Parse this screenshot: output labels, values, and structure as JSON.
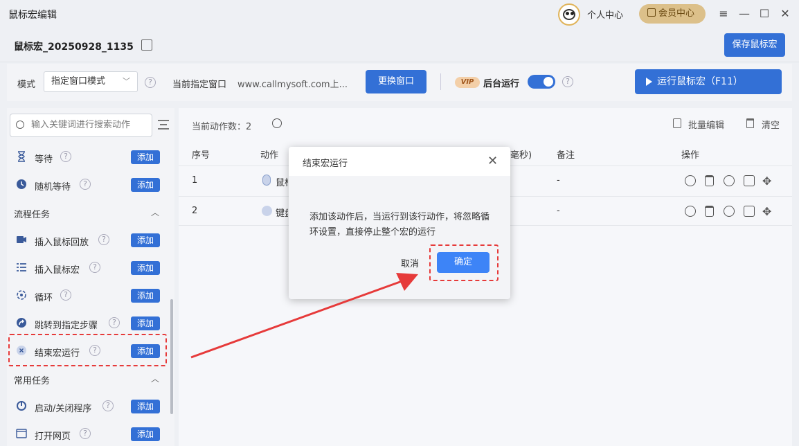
{
  "titlebar": {
    "app_title": "鼠标宏编辑",
    "personal_center": "个人中心",
    "member_center": "会员中心",
    "minimize_glyph": "—",
    "maximize_glyph": "☐",
    "close_glyph": "✕"
  },
  "macro": {
    "name": "鼠标宏_20250928_1135",
    "save_label": "保存鼠标宏"
  },
  "modebar": {
    "mode_label": "模式",
    "mode_value": "指定窗口模式",
    "window_label": "当前指定窗口",
    "window_value": "www.callmysoft.com上...",
    "change_window_label": "更换窗口",
    "vip_badge": "VIP",
    "background_run_label": "后台运行",
    "run_label": "运行鼠标宏（F11）"
  },
  "sidebar": {
    "search_placeholder": "输入关键词进行搜索动作",
    "add_label": "添加",
    "items_top": [
      {
        "label": "等待",
        "icon": "hourglass-icon"
      },
      {
        "label": "随机等待",
        "icon": "clock-icon"
      }
    ],
    "section_flow": "流程任务",
    "items_flow": [
      {
        "label": "插入鼠标回放",
        "icon": "video-icon"
      },
      {
        "label": "插入鼠标宏",
        "icon": "list-icon"
      },
      {
        "label": "循环",
        "icon": "loop-icon"
      },
      {
        "label": "跳转到指定步骤",
        "icon": "jump-icon"
      },
      {
        "label": "结束宏运行",
        "icon": "stop-icon"
      }
    ],
    "section_common": "常用任务",
    "items_common": [
      {
        "label": "启动/关闭程序",
        "icon": "power-icon"
      },
      {
        "label": "打开网页",
        "icon": "browser-icon"
      }
    ]
  },
  "table": {
    "count_label": "当前动作数：",
    "count_value": "2",
    "batch_edit": "批量编辑",
    "clear": "清空",
    "headers": {
      "index": "序号",
      "action": "动作",
      "delay": "毫秒)",
      "note": "备注",
      "ops": "操作"
    },
    "rows": [
      {
        "index": "1",
        "action": "鼠标",
        "note": "-"
      },
      {
        "index": "2",
        "action": "键盘",
        "note": "-"
      }
    ]
  },
  "dialog": {
    "title": "结束宏运行",
    "close_glyph": "✕",
    "message": "添加该动作后，当运行到该行动作，将忽略循环设置，直接停止整个宏的运行",
    "cancel": "取消",
    "confirm": "确定"
  },
  "colors": {
    "primary": "#3370d6",
    "confirm": "#3d84f7",
    "highlight": "#e63a3a"
  }
}
